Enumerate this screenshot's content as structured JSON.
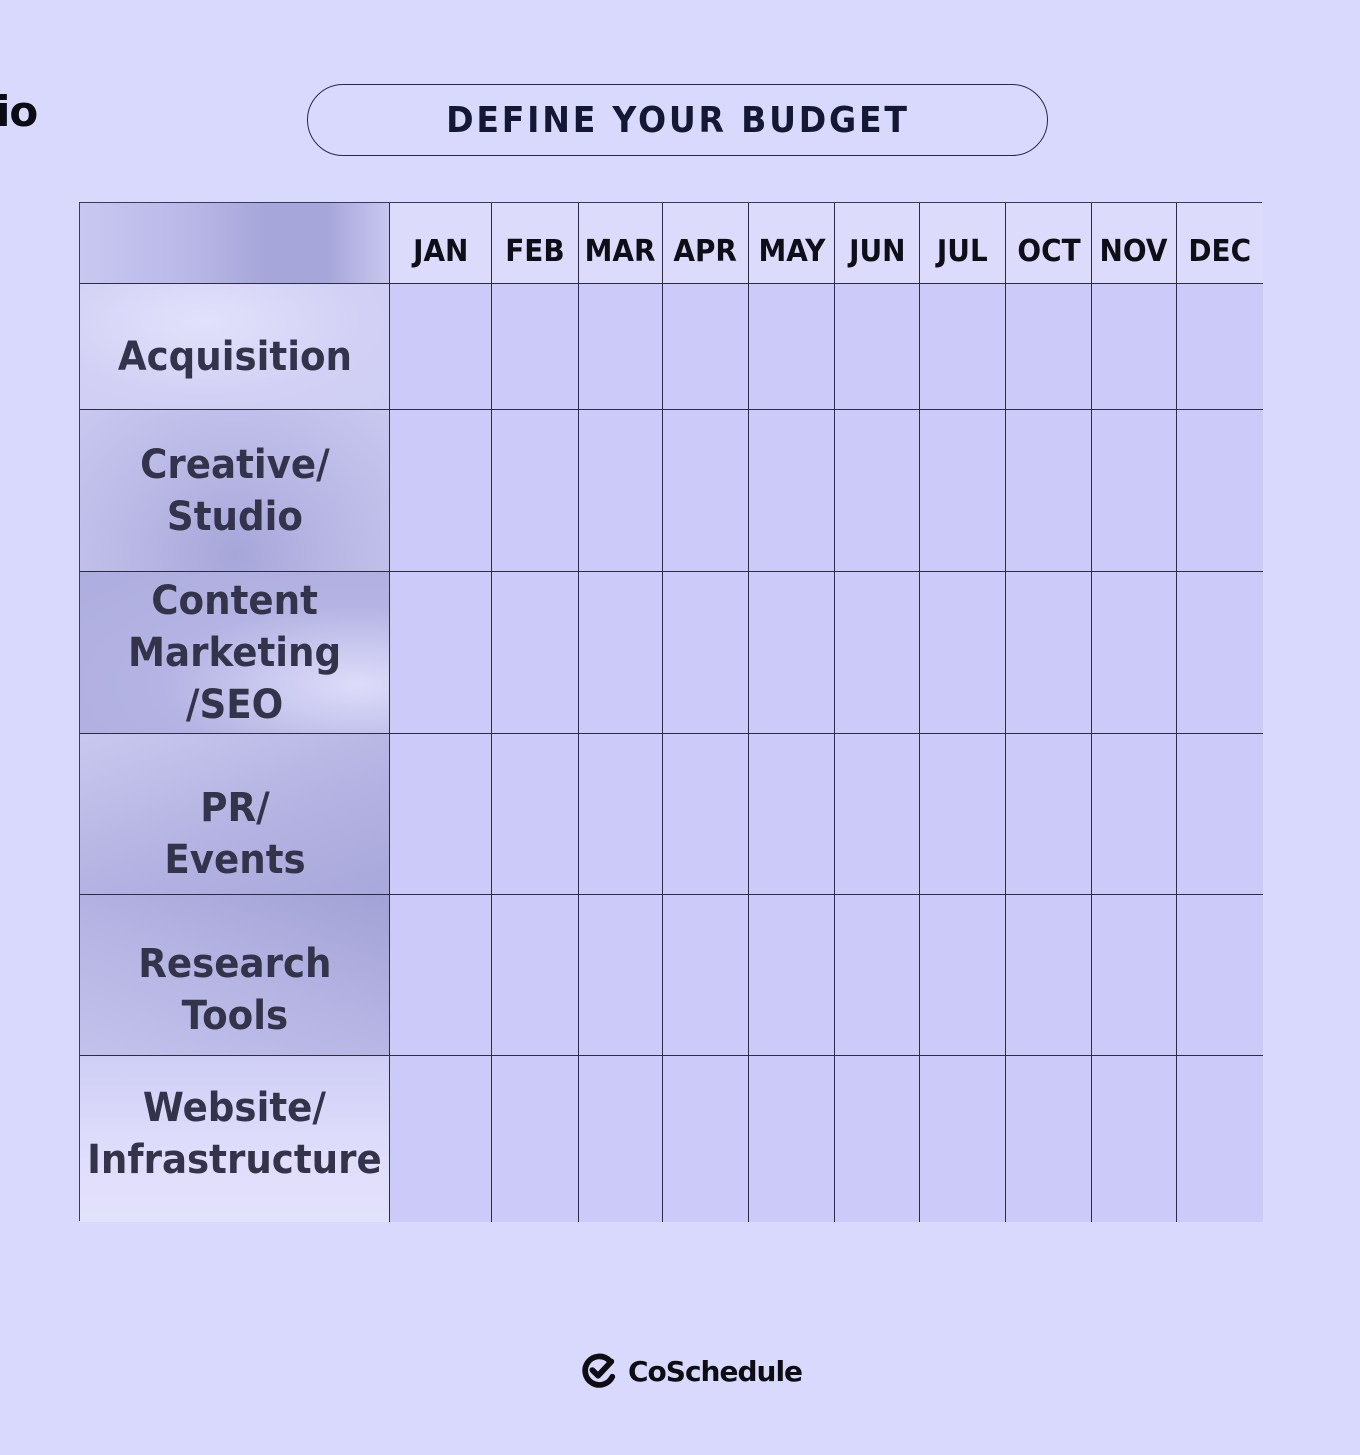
{
  "edge_text": "io",
  "title": "DEFINE YOUR BUDGET",
  "table": {
    "corner_label": "",
    "months": [
      "JAN",
      "FEB",
      "MAR",
      "APR",
      "MAY",
      "JUN",
      "JUL",
      "OCT",
      "NOV",
      "DEC"
    ],
    "rows": [
      {
        "label": "Acquisition",
        "values": [
          "",
          "",
          "",
          "",
          "",
          "",
          "",
          "",
          "",
          ""
        ]
      },
      {
        "label": "Creative/\nStudio",
        "values": [
          "",
          "",
          "",
          "",
          "",
          "",
          "",
          "",
          "",
          ""
        ]
      },
      {
        "label": "Content\nMarketing\n/SEO",
        "values": [
          "",
          "",
          "",
          "",
          "",
          "",
          "",
          "",
          "",
          ""
        ]
      },
      {
        "label": "PR/\nEvents",
        "values": [
          "",
          "",
          "",
          "",
          "",
          "",
          "",
          "",
          "",
          ""
        ]
      },
      {
        "label": "Research\nTools",
        "values": [
          "",
          "",
          "",
          "",
          "",
          "",
          "",
          "",
          "",
          ""
        ]
      },
      {
        "label": "Website/\nInfrastructure",
        "values": [
          "",
          "",
          "",
          "",
          "",
          "",
          "",
          "",
          "",
          ""
        ]
      }
    ]
  },
  "brand": {
    "icon": "coschedule-check-logo-icon",
    "name": "CoSchedule"
  },
  "colors": {
    "background": "#d9d8fd",
    "cell_fill": "#cbcaf9",
    "header_fill": "#dcdbfc",
    "text_dark": "#141833"
  }
}
